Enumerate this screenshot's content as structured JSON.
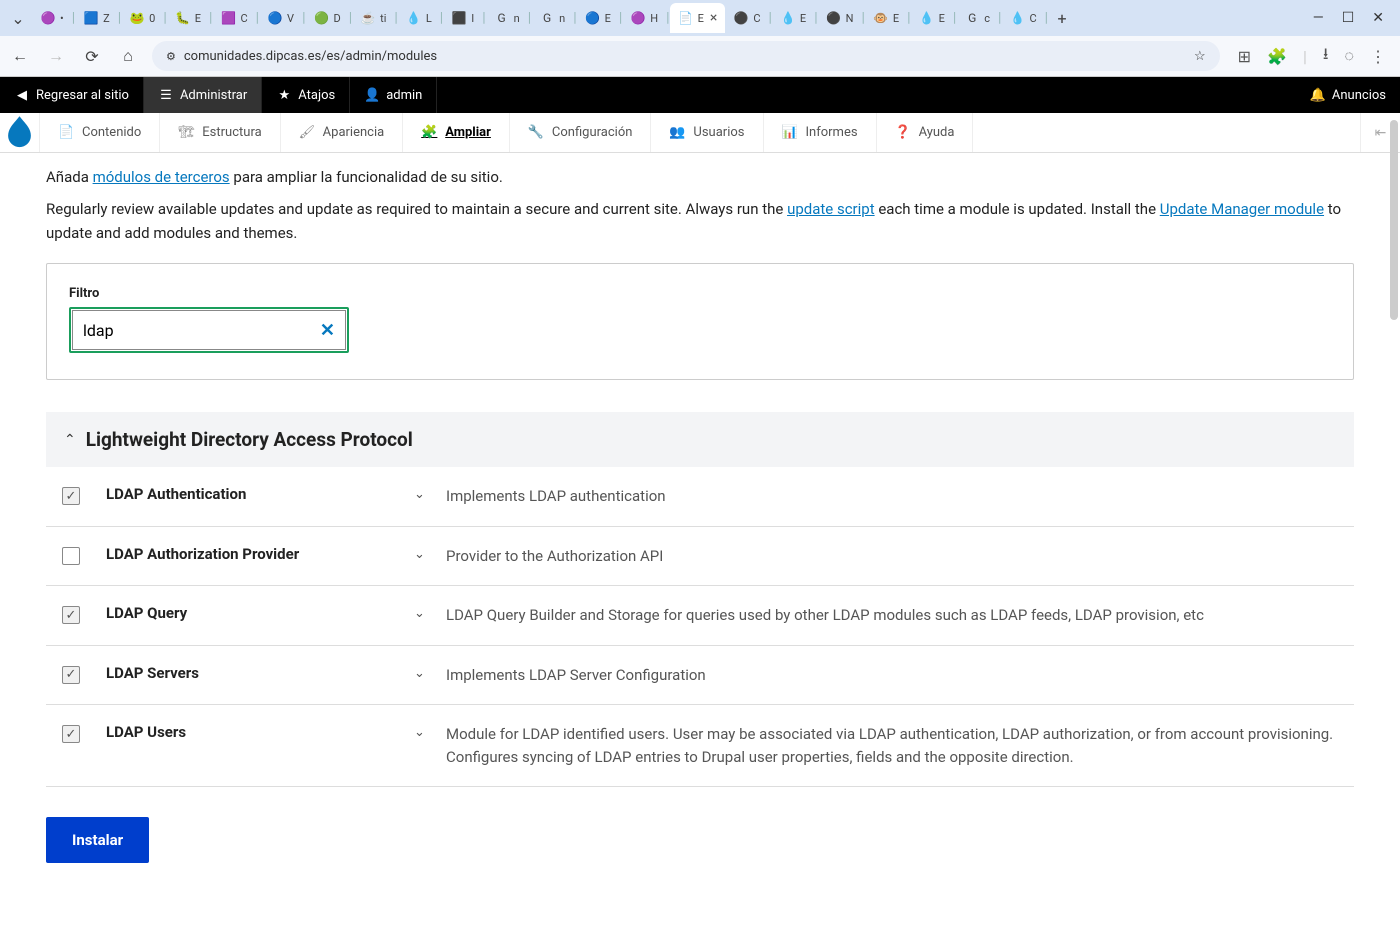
{
  "browser": {
    "tabs": [
      {
        "label": "•",
        "favicon": "🟣"
      },
      {
        "label": "Z",
        "favicon": "🟦"
      },
      {
        "label": "0",
        "favicon": "🐸"
      },
      {
        "label": "E",
        "favicon": "🐛"
      },
      {
        "label": "C",
        "favicon": "🟪"
      },
      {
        "label": "V",
        "favicon": "🔵"
      },
      {
        "label": "D",
        "favicon": "🟢"
      },
      {
        "label": "ti",
        "favicon": "☕"
      },
      {
        "label": "L",
        "favicon": "💧"
      },
      {
        "label": "I",
        "favicon": "⬛"
      },
      {
        "label": "n",
        "favicon": "G"
      },
      {
        "label": "n",
        "favicon": "G"
      },
      {
        "label": "E",
        "favicon": "🔵"
      },
      {
        "label": "H",
        "favicon": "🟣"
      },
      {
        "label": "E",
        "favicon": "📄",
        "active": true
      },
      {
        "label": "C",
        "favicon": "⚫"
      },
      {
        "label": "E",
        "favicon": "💧"
      },
      {
        "label": "N",
        "favicon": "⚫"
      },
      {
        "label": "E",
        "favicon": "🐵"
      },
      {
        "label": "E",
        "favicon": "💧"
      },
      {
        "label": "c",
        "favicon": "G"
      },
      {
        "label": "C",
        "favicon": "💧"
      }
    ],
    "url": "comunidades.dipcas.es/es/admin/modules"
  },
  "topbar": {
    "back_to_site": "Regresar al sitio",
    "manage": "Administrar",
    "shortcuts": "Atajos",
    "user": "admin",
    "announcements": "Anuncios"
  },
  "admin_menu": {
    "items": [
      {
        "label": "Contenido",
        "icon": "file"
      },
      {
        "label": "Estructura",
        "icon": "tree"
      },
      {
        "label": "Apariencia",
        "icon": "brush"
      },
      {
        "label": "Ampliar",
        "icon": "puzzle",
        "active": true
      },
      {
        "label": "Configuración",
        "icon": "wrench"
      },
      {
        "label": "Usuarios",
        "icon": "users"
      },
      {
        "label": "Informes",
        "icon": "chart"
      },
      {
        "label": "Ayuda",
        "icon": "help"
      }
    ]
  },
  "intro": {
    "line1_pre": "Añada ",
    "line1_link": "módulos de terceros",
    "line1_post": " para ampliar la funcionalidad de su sitio.",
    "line2_pre": "Regularly review available updates and update as required to maintain a secure and current site. Always run the ",
    "line2_link1": "update script",
    "line2_mid": " each time a module is updated. Install the ",
    "line2_link2": "Update Manager module",
    "line2_post": " to update and add modules and themes."
  },
  "filter": {
    "label": "Filtro",
    "value": "ldap"
  },
  "group": {
    "title": "Lightweight Directory Access Protocol"
  },
  "modules": [
    {
      "name": "LDAP Authentication",
      "desc": "Implements LDAP authentication",
      "checked": true
    },
    {
      "name": "LDAP Authorization Provider",
      "desc": "Provider to the Authorization API",
      "checked": false
    },
    {
      "name": "LDAP Query",
      "desc": "LDAP Query Builder and Storage for queries used by other LDAP modules such as LDAP feeds, LDAP provision, etc",
      "checked": true
    },
    {
      "name": "LDAP Servers",
      "desc": "Implements LDAP Server Configuration",
      "checked": true
    },
    {
      "name": "LDAP Users",
      "desc": "Module for LDAP identified users. User may be associated via LDAP authentication, LDAP authorization, or from account provisioning. Configures syncing of LDAP entries to Drupal user properties, fields and the opposite direction.",
      "checked": true
    }
  ],
  "install_button": "Instalar"
}
